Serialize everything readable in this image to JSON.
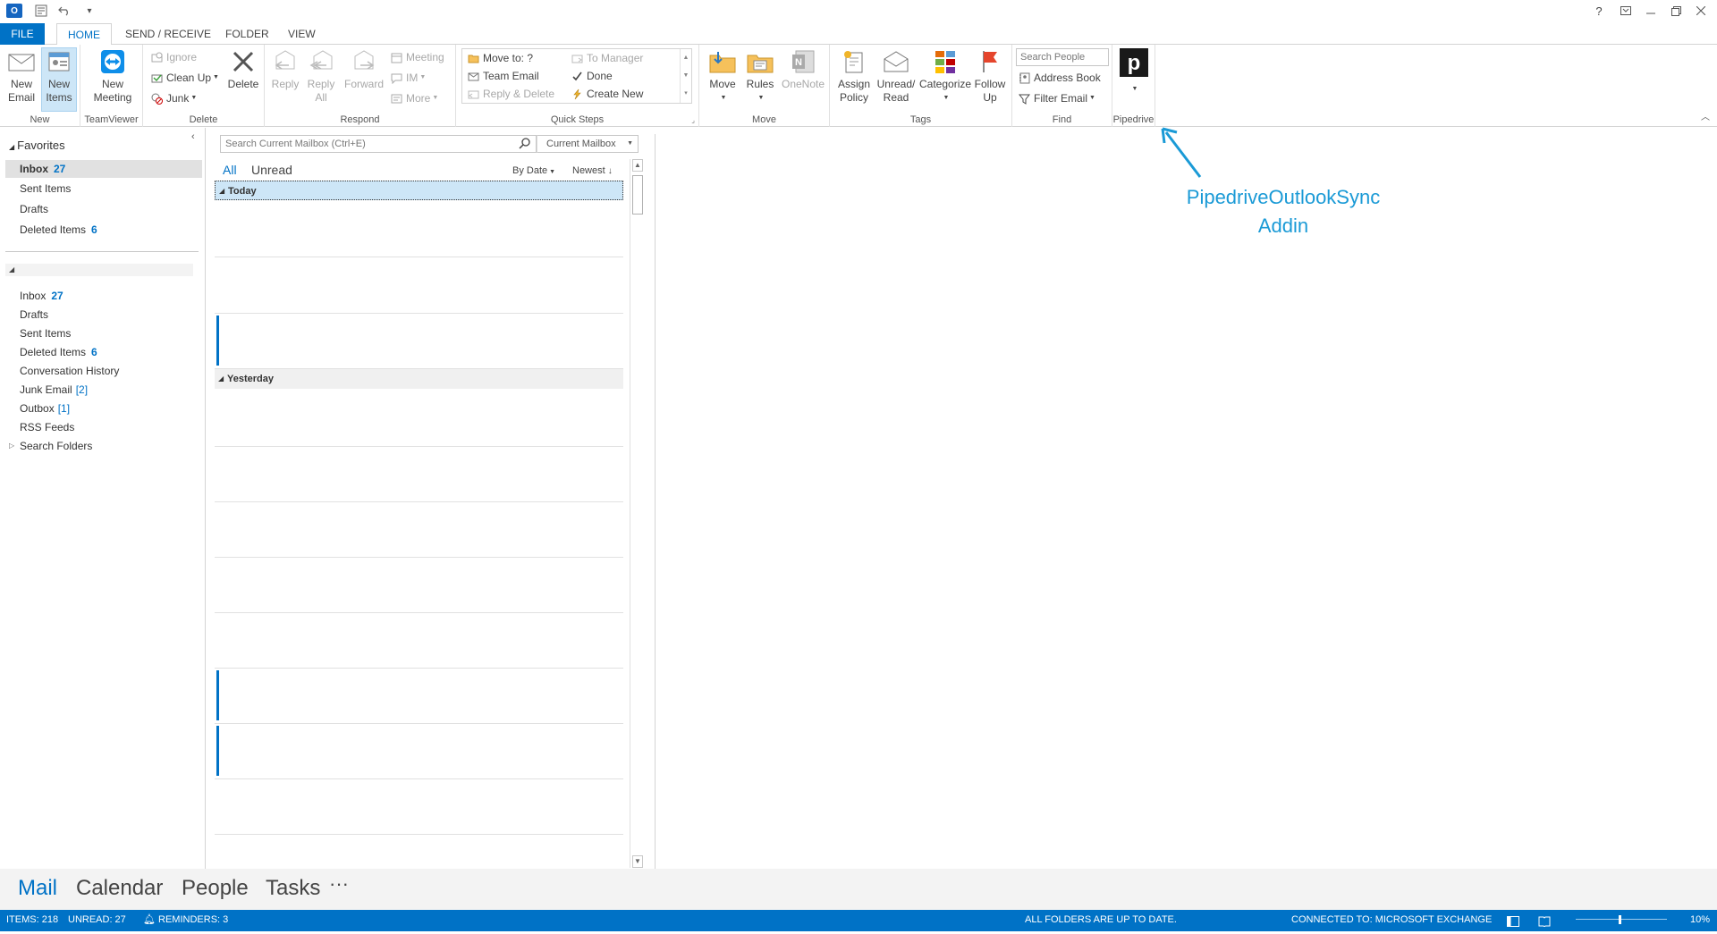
{
  "titlebar": {
    "app_icon": "O",
    "help": "?",
    "quick_access_dropdown": "▾"
  },
  "tabs": [
    "FILE",
    "HOME",
    "SEND / RECEIVE",
    "FOLDER",
    "VIEW"
  ],
  "ribbon": {
    "new": {
      "label": "New",
      "new_email": "New Email",
      "new_items": "New Items"
    },
    "teamviewer": {
      "label": "TeamViewer",
      "new_meeting": "New Meeting"
    },
    "delete": {
      "label": "Delete",
      "ignore": "Ignore",
      "clean_up": "Clean Up",
      "junk": "Junk",
      "delete": "Delete"
    },
    "respond": {
      "label": "Respond",
      "reply": "Reply",
      "reply_all": "Reply All",
      "forward": "Forward",
      "meeting": "Meeting",
      "im": "IM",
      "more": "More"
    },
    "quick_steps": {
      "label": "Quick Steps",
      "items": [
        "Move to: ?",
        "Team Email",
        "Reply & Delete",
        "To Manager",
        "Done",
        "Create New"
      ]
    },
    "move": {
      "label": "Move",
      "move": "Move",
      "rules": "Rules",
      "onenote": "OneNote"
    },
    "tags": {
      "label": "Tags",
      "assign_policy": "Assign Policy",
      "unread_read": "Unread/ Read",
      "categorize": "Categorize",
      "follow_up": "Follow Up"
    },
    "find": {
      "label": "Find",
      "search_people": "Search People",
      "address_book": "Address Book",
      "filter_email": "Filter Email"
    },
    "pipedrive": {
      "label": "Pipedrive",
      "logo": "p"
    }
  },
  "nav": {
    "favorites_header": "Favorites",
    "favorites": [
      {
        "name": "Inbox",
        "count": "27"
      },
      {
        "name": "Sent Items",
        "count": ""
      },
      {
        "name": "Drafts",
        "count": ""
      },
      {
        "name": "Deleted Items",
        "count": "6"
      }
    ],
    "folders": [
      {
        "name": "Inbox",
        "count": "27"
      },
      {
        "name": "Drafts",
        "count": ""
      },
      {
        "name": "Sent Items",
        "count": ""
      },
      {
        "name": "Deleted Items",
        "count": "6"
      },
      {
        "name": "Conversation History",
        "count": ""
      },
      {
        "name": "Junk Email",
        "count": "[2]"
      },
      {
        "name": "Outbox",
        "count": "[1]"
      },
      {
        "name": "RSS Feeds",
        "count": ""
      },
      {
        "name": "Search Folders",
        "count": ""
      }
    ]
  },
  "list": {
    "search_placeholder": "Search Current Mailbox (Ctrl+E)",
    "scope": "Current Mailbox",
    "filter_all": "All",
    "filter_unread": "Unread",
    "sort_by": "By Date",
    "sort_order": "Newest",
    "group_today": "Today",
    "group_yesterday": "Yesterday"
  },
  "annotation": {
    "line1": "PipedriveOutlookSync",
    "line2": "Addin"
  },
  "bottom_nav": [
    "Mail",
    "Calendar",
    "People",
    "Tasks",
    "···"
  ],
  "status": {
    "items": "ITEMS: 218",
    "unread": "UNREAD: 27",
    "reminders": "REMINDERS: 3",
    "folders": "ALL FOLDERS ARE UP TO DATE.",
    "connection": "CONNECTED TO: MICROSOFT EXCHANGE",
    "zoom": "10%"
  },
  "colors": {
    "accent": "#0072c6",
    "annotation": "#1a9ad6"
  }
}
